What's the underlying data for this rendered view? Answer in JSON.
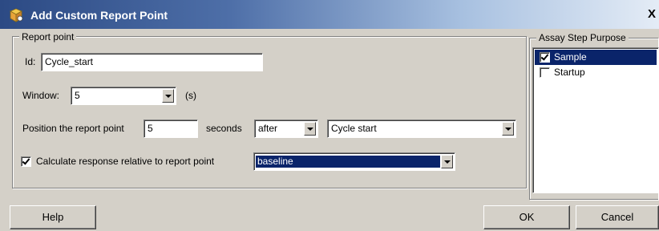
{
  "window": {
    "title": "Add Custom Report Point",
    "close_glyph": "X"
  },
  "report_point": {
    "group_label": "Report point",
    "id_label": "Id:",
    "id_value": "Cycle_start",
    "window_label": "Window:",
    "window_value": "5",
    "window_unit": "(s)",
    "position_label": "Position the report point",
    "position_value": "5",
    "seconds_label": "seconds",
    "direction_value": "after",
    "event_value": "Cycle start",
    "calc_checked": true,
    "calc_label": "Calculate response relative to report point",
    "relative_value": "baseline"
  },
  "assay_step": {
    "group_label": "Assay Step Purpose",
    "items": [
      {
        "label": "Sample",
        "checked": true,
        "selected": true
      },
      {
        "label": "Startup",
        "checked": false,
        "selected": false
      }
    ]
  },
  "buttons": {
    "help": "Help",
    "ok": "OK",
    "cancel": "Cancel"
  },
  "colors": {
    "selection": "#0a246a",
    "dialog_bg": "#d4d0c8",
    "title_start": "#2c4a84"
  },
  "icons": {
    "title": "report-point-icon",
    "close": "close-icon",
    "dropdown": "chevron-down-icon"
  }
}
